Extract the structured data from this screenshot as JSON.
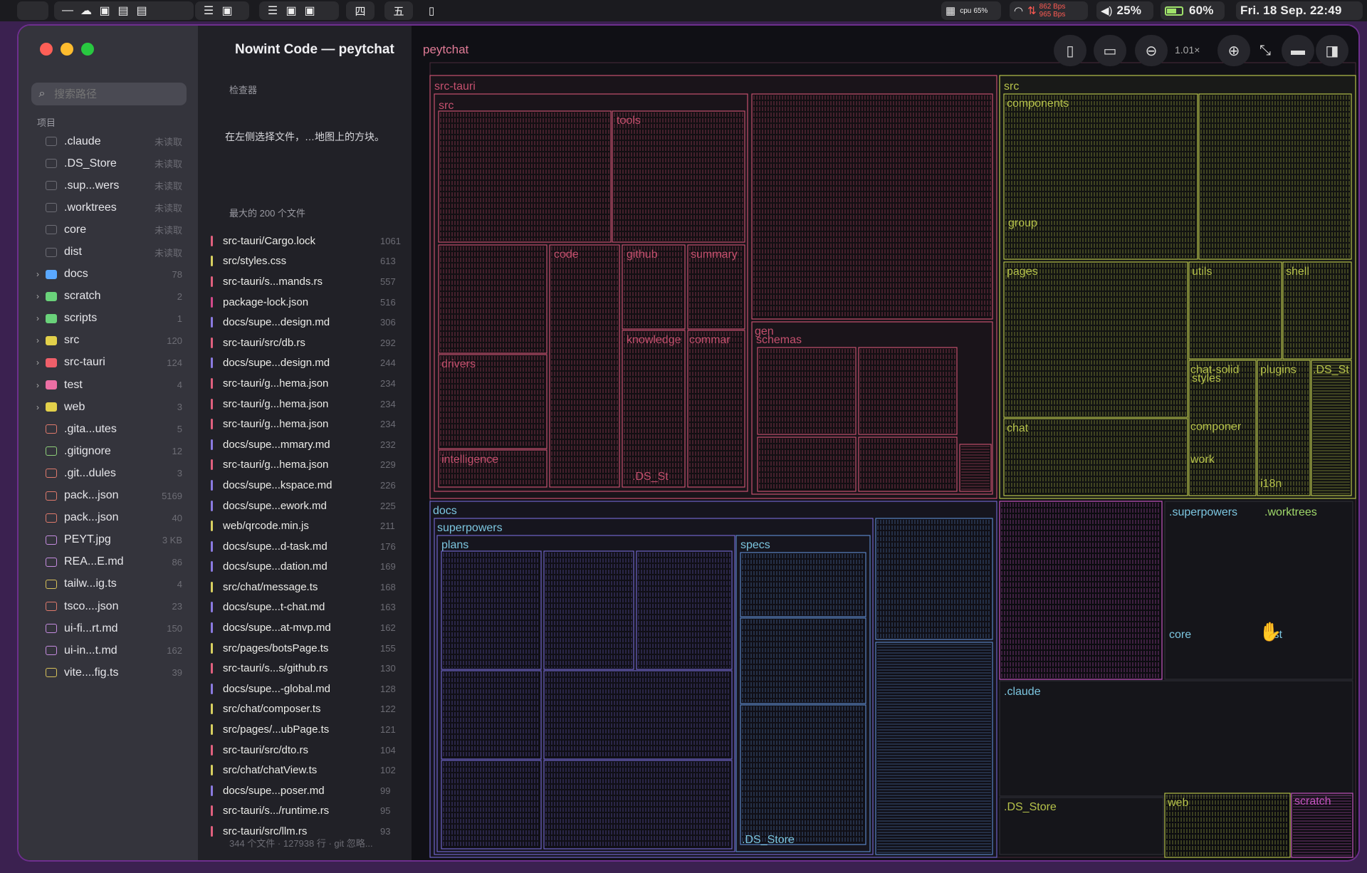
{
  "menubar": {
    "apple_glyph": "",
    "ws_four": "四",
    "ws_five": "五",
    "cpu_label": "cpu",
    "cpu_value": "65%",
    "net_up": "862",
    "net_down": "965",
    "net_unit": "Bps",
    "volume": "25%",
    "battery": "60%",
    "clock": "Fri. 18 Sep. 22:49"
  },
  "sidebar": {
    "search_placeholder": "搜索路径",
    "section_label": "项目",
    "items": [
      {
        "name": ".claude",
        "meta": "未读取",
        "kind": "folder-dim"
      },
      {
        "name": ".DS_Store",
        "meta": "未读取",
        "kind": "file-dim"
      },
      {
        "name": ".sup...wers",
        "meta": "未读取",
        "kind": "folder-dim"
      },
      {
        "name": ".worktrees",
        "meta": "未读取",
        "kind": "folder-dim"
      },
      {
        "name": "core",
        "meta": "未读取",
        "kind": "folder-dim"
      },
      {
        "name": "dist",
        "meta": "未读取",
        "kind": "folder-dim"
      },
      {
        "name": "docs",
        "meta": "78",
        "kind": "folder-blue"
      },
      {
        "name": "scratch",
        "meta": "2",
        "kind": "folder-green"
      },
      {
        "name": "scripts",
        "meta": "1",
        "kind": "folder-green"
      },
      {
        "name": "src",
        "meta": "120",
        "kind": "folder-yellow"
      },
      {
        "name": "src-tauri",
        "meta": "124",
        "kind": "folder-red"
      },
      {
        "name": "test",
        "meta": "4",
        "kind": "folder-pink"
      },
      {
        "name": "web",
        "meta": "3",
        "kind": "folder-yellow"
      },
      {
        "name": ".gita...utes",
        "meta": "5",
        "kind": "file-red"
      },
      {
        "name": ".gitignore",
        "meta": "12",
        "kind": "file-green"
      },
      {
        "name": ".git...dules",
        "meta": "3",
        "kind": "file-red"
      },
      {
        "name": "pack...json",
        "meta": "5169",
        "kind": "file-red"
      },
      {
        "name": "pack...json",
        "meta": "40",
        "kind": "file-red"
      },
      {
        "name": "PEYT.jpg",
        "meta": "3 KB",
        "kind": "file-purple"
      },
      {
        "name": "REA...E.md",
        "meta": "86",
        "kind": "file-purple"
      },
      {
        "name": "tailw...ig.ts",
        "meta": "4",
        "kind": "file-yellow"
      },
      {
        "name": "tsco....json",
        "meta": "23",
        "kind": "file-red"
      },
      {
        "name": "ui-fi...rt.md",
        "meta": "150",
        "kind": "file-purple"
      },
      {
        "name": "ui-in...t.md",
        "meta": "162",
        "kind": "file-purple"
      },
      {
        "name": "vite....fig.ts",
        "meta": "39",
        "kind": "file-yellow"
      }
    ]
  },
  "inspector": {
    "title": "Nowint Code — peytchat",
    "section_inspector": "检查器",
    "hint": "在左侧选择文件，…地图上的方块。",
    "section_top": "最大的 200 个文件",
    "files": [
      {
        "path": "src-tauri/Cargo.lock",
        "count": "1061",
        "color": "#e0607e"
      },
      {
        "path": "src/styles.css",
        "count": "613",
        "color": "#d8d060"
      },
      {
        "path": "src-tauri/s...mands.rs",
        "count": "557",
        "color": "#e0607e"
      },
      {
        "path": "package-lock.json",
        "count": "516",
        "color": "#d24a8a"
      },
      {
        "path": "docs/supe...design.md",
        "count": "306",
        "color": "#8a7ae0"
      },
      {
        "path": "src-tauri/src/db.rs",
        "count": "292",
        "color": "#e0607e"
      },
      {
        "path": "docs/supe...design.md",
        "count": "244",
        "color": "#8a7ae0"
      },
      {
        "path": "src-tauri/g...hema.json",
        "count": "234",
        "color": "#e0607e"
      },
      {
        "path": "src-tauri/g...hema.json",
        "count": "234",
        "color": "#e0607e"
      },
      {
        "path": "src-tauri/g...hema.json",
        "count": "234",
        "color": "#e0607e"
      },
      {
        "path": "docs/supe...mmary.md",
        "count": "232",
        "color": "#8a7ae0"
      },
      {
        "path": "src-tauri/g...hema.json",
        "count": "229",
        "color": "#e0607e"
      },
      {
        "path": "docs/supe...kspace.md",
        "count": "226",
        "color": "#8a7ae0"
      },
      {
        "path": "docs/supe...ework.md",
        "count": "225",
        "color": "#8a7ae0"
      },
      {
        "path": "web/qrcode.min.js",
        "count": "211",
        "color": "#d8d060"
      },
      {
        "path": "docs/supe...d-task.md",
        "count": "176",
        "color": "#8a7ae0"
      },
      {
        "path": "docs/supe...dation.md",
        "count": "169",
        "color": "#8a7ae0"
      },
      {
        "path": "src/chat/message.ts",
        "count": "168",
        "color": "#d8d060"
      },
      {
        "path": "docs/supe...t-chat.md",
        "count": "163",
        "color": "#8a7ae0"
      },
      {
        "path": "docs/supe...at-mvp.md",
        "count": "162",
        "color": "#8a7ae0"
      },
      {
        "path": "src/pages/botsPage.ts",
        "count": "155",
        "color": "#d8d060"
      },
      {
        "path": "src-tauri/s...s/github.rs",
        "count": "130",
        "color": "#e0607e"
      },
      {
        "path": "docs/supe...-global.md",
        "count": "128",
        "color": "#8a7ae0"
      },
      {
        "path": "src/chat/composer.ts",
        "count": "122",
        "color": "#d8d060"
      },
      {
        "path": "src/pages/...ubPage.ts",
        "count": "121",
        "color": "#d8d060"
      },
      {
        "path": "src-tauri/src/dto.rs",
        "count": "104",
        "color": "#e0607e"
      },
      {
        "path": "src/chat/chatView.ts",
        "count": "102",
        "color": "#d8d060"
      },
      {
        "path": "docs/supe...poser.md",
        "count": "99",
        "color": "#8a7ae0"
      },
      {
        "path": "src-tauri/s.../runtime.rs",
        "count": "95",
        "color": "#e0607e"
      },
      {
        "path": "src-tauri/src/llm.rs",
        "count": "93",
        "color": "#e0607e"
      }
    ],
    "footer": "344 个文件 · 127938 行 · git 忽略..."
  },
  "toolbar": {
    "breadcrumb": "peytchat",
    "zoom_level": "1.01×",
    "icons": [
      "sidebar-toggle-icon",
      "folder-add-icon",
      "zoom-out-icon",
      "zoom-in-icon",
      "expand-icon",
      "panel-bottom-icon",
      "panel-right-icon"
    ]
  },
  "treemap": {
    "colors": {
      "src_tauri": "#c5506e",
      "src": "#b6c24a",
      "docs": "#6f64c8",
      "specs": "#5a84c4",
      "claude": "#c555c0",
      "misc": "#7cc6e0",
      "worktrees": "#9fd86a"
    },
    "labels": {
      "src_tauri": "src-tauri",
      "src_tauri_src": "src",
      "tools": "tools",
      "code": "code",
      "github": "github",
      "summary": "summary",
      "knowledge": "knowledge",
      "commands": "commar",
      "drivers": "drivers",
      "intelligence": "intelligence",
      "ds_store_inner": ".DS_St",
      "gen": "gen",
      "schemas": "schemas",
      "src": "src",
      "components": "components",
      "group": "group",
      "pages": "pages",
      "utils": "utils",
      "shell": "shell",
      "chat_solid": "chat-solid",
      "styles": "styles",
      "plugins": "plugins",
      "ds_store_src": ".DS_St",
      "chat": "chat",
      "components_small": "componer",
      "work": "work",
      "i18n": "i18n",
      "docs": "docs",
      "superpowers": "superpowers",
      "plans": "plans",
      "specs": "specs",
      "ds_store_specs": ".DS_Store",
      "superpowers_hidden": ".superpowers",
      "worktrees": ".worktrees",
      "core": "core",
      "dist": "dist",
      "claude": ".claude",
      "ds_store_root": ".DS_Store",
      "web": "web",
      "scratch": "scratch"
    }
  }
}
